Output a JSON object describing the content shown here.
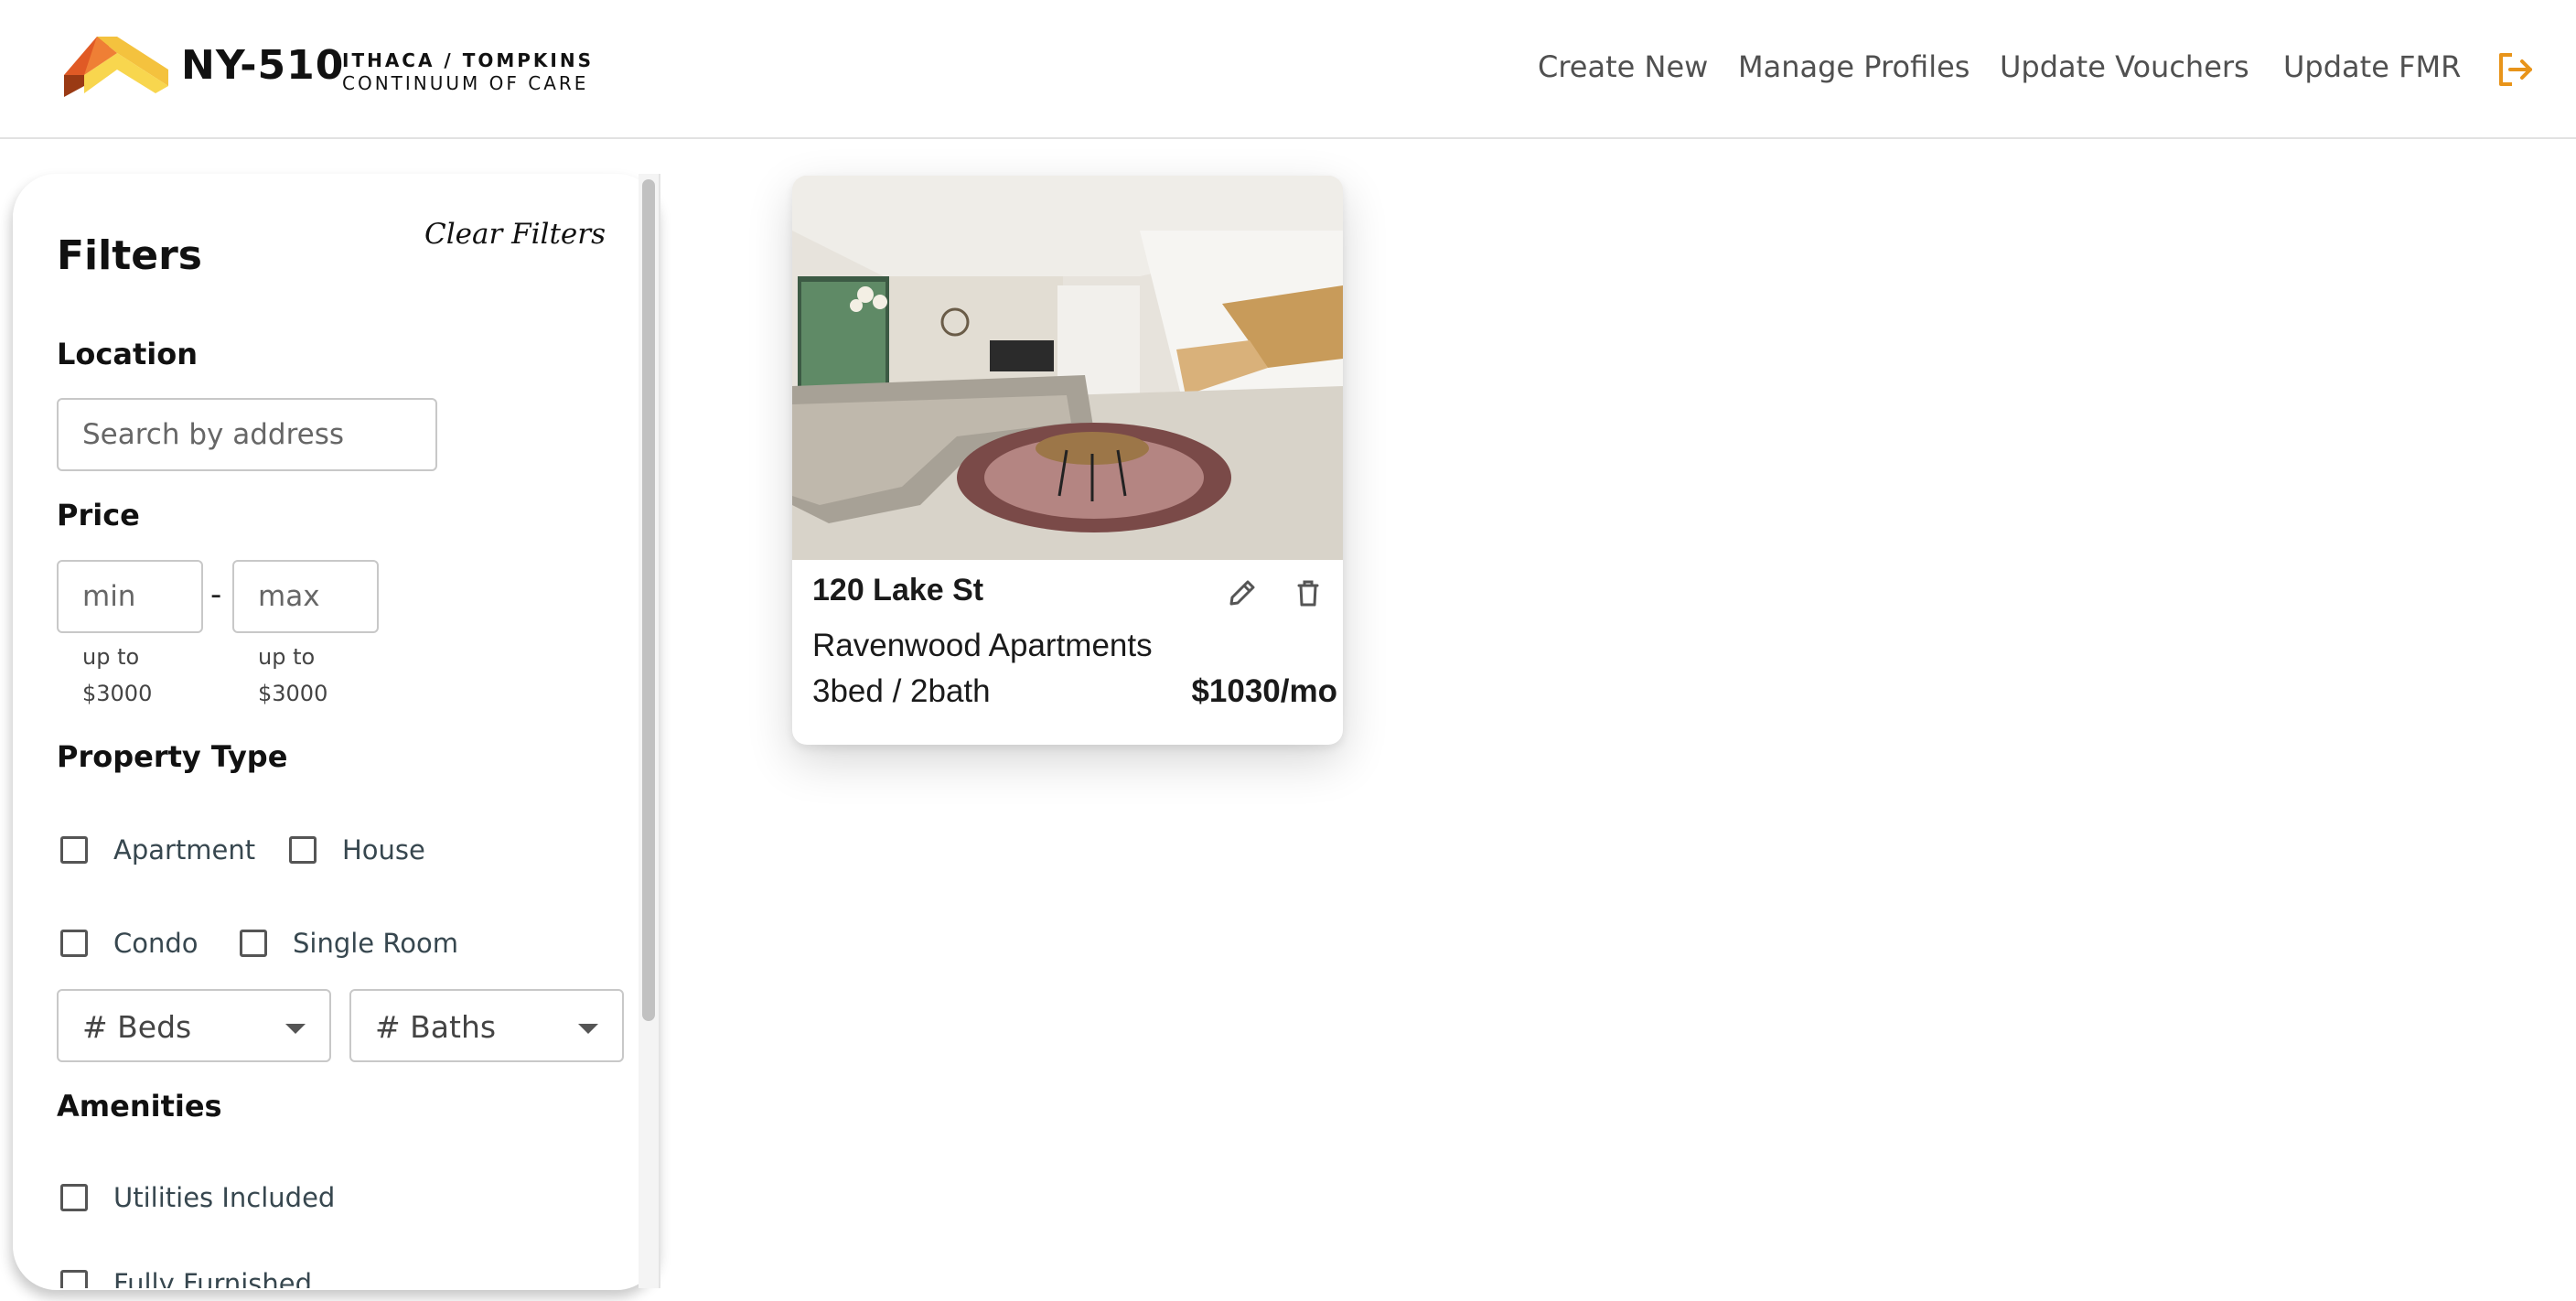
{
  "header": {
    "brand_code": "NY-510",
    "brand_line1": "ITHACA / TOMPKINS",
    "brand_line2": "CONTINUUM OF CARE",
    "nav": [
      {
        "label": "Create New"
      },
      {
        "label": "Manage Profiles"
      },
      {
        "label": "Update Vouchers"
      },
      {
        "label": "Update FMR"
      }
    ],
    "logout_icon": "logout-icon",
    "accent_color": "#e8941a"
  },
  "filters": {
    "title": "Filters",
    "clear_label": "Clear Filters",
    "location": {
      "label": "Location",
      "placeholder": "Search by address",
      "value": ""
    },
    "price": {
      "label": "Price",
      "min_placeholder": "min",
      "max_placeholder": "max",
      "separator": "-",
      "min_hint_line1": "up to",
      "min_hint_line2": "$3000",
      "max_hint_line1": "up to",
      "max_hint_line2": "$3000"
    },
    "property_type": {
      "label": "Property Type",
      "options": [
        {
          "label": "Apartment",
          "checked": false
        },
        {
          "label": "House",
          "checked": false
        },
        {
          "label": "Condo",
          "checked": false
        },
        {
          "label": "Single Room",
          "checked": false
        }
      ]
    },
    "beds_select": "# Beds",
    "baths_select": "# Baths",
    "amenities": {
      "label": "Amenities",
      "options": [
        {
          "label": "Utilities Included",
          "checked": false
        },
        {
          "label": "Fully Furnished",
          "checked": false
        }
      ]
    }
  },
  "listings": [
    {
      "address": "120 Lake St",
      "name": "Ravenwood Apartments",
      "beds_baths": "3bed / 2bath",
      "price": "$1030/mo",
      "edit_icon": "pencil-icon",
      "delete_icon": "trash-icon"
    }
  ]
}
